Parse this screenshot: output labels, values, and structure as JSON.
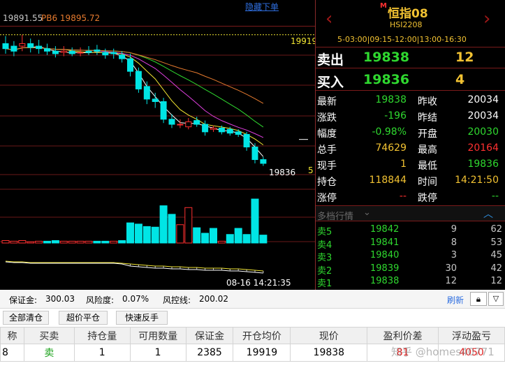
{
  "chart": {
    "ma_label": "19891.55",
    "pb_label": "PB6 19895.72",
    "hide_link": "隐藏下单",
    "high_price": "19919",
    "last_price": "19836",
    "arrow_label": "5",
    "datetime": "08-16 14:21:35",
    "candles": [
      {
        "o": 19912,
        "c": 19908,
        "h": 19918,
        "l": 19904
      },
      {
        "o": 19910,
        "c": 19906,
        "h": 19914,
        "l": 19902
      },
      {
        "o": 19910,
        "c": 19912,
        "h": 19919,
        "l": 19906
      },
      {
        "o": 19912,
        "c": 19909,
        "h": 19916,
        "l": 19905
      },
      {
        "o": 19910,
        "c": 19908,
        "h": 19915,
        "l": 19904
      },
      {
        "o": 19908,
        "c": 19906,
        "h": 19912,
        "l": 19903
      },
      {
        "o": 19906,
        "c": 19904,
        "h": 19910,
        "l": 19901
      },
      {
        "o": 19905,
        "c": 19906,
        "h": 19910,
        "l": 19902
      },
      {
        "o": 19906,
        "c": 19904,
        "h": 19909,
        "l": 19902
      },
      {
        "o": 19905,
        "c": 19905,
        "h": 19909,
        "l": 19902
      },
      {
        "o": 19906,
        "c": 19905,
        "h": 19910,
        "l": 19903
      },
      {
        "o": 19907,
        "c": 19906,
        "h": 19911,
        "l": 19903
      },
      {
        "o": 19905,
        "c": 19903,
        "h": 19908,
        "l": 19900
      },
      {
        "o": 19905,
        "c": 19904,
        "h": 19908,
        "l": 19900
      },
      {
        "o": 19903,
        "c": 19900,
        "h": 19906,
        "l": 19897
      },
      {
        "o": 19900,
        "c": 19890,
        "h": 19904,
        "l": 19886
      },
      {
        "o": 19890,
        "c": 19876,
        "h": 19893,
        "l": 19873
      },
      {
        "o": 19878,
        "c": 19868,
        "h": 19882,
        "l": 19864
      },
      {
        "o": 19868,
        "c": 19866,
        "h": 19873,
        "l": 19861
      },
      {
        "o": 19866,
        "c": 19852,
        "h": 19869,
        "l": 19849
      },
      {
        "o": 19852,
        "c": 19848,
        "h": 19856,
        "l": 19845
      },
      {
        "o": 19848,
        "c": 19848,
        "h": 19852,
        "l": 19845
      },
      {
        "o": 19846,
        "c": 19850,
        "h": 19853,
        "l": 19844
      },
      {
        "o": 19851,
        "c": 19848,
        "h": 19854,
        "l": 19846
      },
      {
        "o": 19848,
        "c": 19842,
        "h": 19851,
        "l": 19839
      },
      {
        "o": 19844,
        "c": 19845,
        "h": 19847,
        "l": 19842
      },
      {
        "o": 19845,
        "c": 19842,
        "h": 19847,
        "l": 19840
      },
      {
        "o": 19844,
        "c": 19841,
        "h": 19846,
        "l": 19839
      },
      {
        "o": 19842,
        "c": 19840,
        "h": 19844,
        "l": 19838
      },
      {
        "o": 19840,
        "c": 19830,
        "h": 19842,
        "l": 19827
      },
      {
        "o": 19830,
        "c": 19820,
        "h": 19833,
        "l": 19817
      },
      {
        "o": 19820,
        "c": 19817,
        "h": 19822,
        "l": 19815
      }
    ],
    "volume": [
      {
        "v": 4,
        "up": true
      },
      {
        "v": 3,
        "up": true
      },
      {
        "v": 4,
        "up": true
      },
      {
        "v": 2,
        "up": true
      },
      {
        "v": 3,
        "up": true
      },
      {
        "v": 3,
        "up": false
      },
      {
        "v": 4,
        "up": false
      },
      {
        "v": 3,
        "up": true
      },
      {
        "v": 3,
        "up": true
      },
      {
        "v": 3,
        "up": true
      },
      {
        "v": 3,
        "up": true
      },
      {
        "v": 3,
        "up": false
      },
      {
        "v": 3,
        "up": false
      },
      {
        "v": 3,
        "up": true
      },
      {
        "v": 4,
        "up": false
      },
      {
        "v": 33,
        "up": false
      },
      {
        "v": 31,
        "up": false
      },
      {
        "v": 27,
        "up": false
      },
      {
        "v": 26,
        "up": false
      },
      {
        "v": 61,
        "up": false
      },
      {
        "v": 47,
        "up": false
      },
      {
        "v": 30,
        "up": true
      },
      {
        "v": 58,
        "up": true
      },
      {
        "v": 25,
        "up": false
      },
      {
        "v": 16,
        "up": false
      },
      {
        "v": 24,
        "up": false
      },
      {
        "v": 3,
        "up": true
      },
      {
        "v": 14,
        "up": false
      },
      {
        "v": 24,
        "up": false
      },
      {
        "v": 14,
        "up": false
      },
      {
        "v": 72,
        "up": false
      },
      {
        "v": 13,
        "up": false
      }
    ]
  },
  "quote": {
    "title": "恒指08",
    "badge": "M",
    "code": "HSI2208",
    "session": "5-03:00|09:15-12:00|13:00-16:30",
    "sell_label": "卖出",
    "sell_price": "19838",
    "sell_qty": "12",
    "buy_label": "买入",
    "buy_price": "19836",
    "buy_qty": "4",
    "rows": [
      {
        "l1": "最新",
        "v1": "19838",
        "c1": "#2fd82f",
        "l2": "昨收",
        "v2": "20034",
        "c2": "#ffffff"
      },
      {
        "l1": "涨跌",
        "v1": "-196",
        "c1": "#2fd82f",
        "l2": "昨结",
        "v2": "20034",
        "c2": "#ffffff"
      },
      {
        "l1": "幅度",
        "v1": "-0.98%",
        "c1": "#2fd82f",
        "l2": "开盘",
        "v2": "20030",
        "c2": "#2fd82f"
      },
      {
        "l1": "总手",
        "v1": "74629",
        "c1": "#f2c232",
        "l2": "最高",
        "v2": "20164",
        "c2": "#ff3030"
      },
      {
        "l1": "现手",
        "v1": "1",
        "c1": "#f2c232",
        "l2": "最低",
        "v2": "19836",
        "c2": "#2fd82f"
      },
      {
        "l1": "持仓",
        "v1": "118844",
        "c1": "#f2c232",
        "l2": "时间",
        "v2": "14:21:50",
        "c2": "#f2c232"
      },
      {
        "l1": "涨停",
        "v1": "--",
        "c1": "#ff3030",
        "l2": "跌停",
        "v2": "--",
        "c2": "#2fd82f"
      }
    ],
    "depth_title": "多档行情",
    "depth": [
      {
        "label": "卖5",
        "price": "19842",
        "qty": "9",
        "total": "62"
      },
      {
        "label": "卖4",
        "price": "19841",
        "qty": "8",
        "total": "53"
      },
      {
        "label": "卖3",
        "price": "19840",
        "qty": "3",
        "total": "45"
      },
      {
        "label": "卖2",
        "price": "19839",
        "qty": "30",
        "total": "42"
      },
      {
        "label": "卖1",
        "price": "19838",
        "qty": "12",
        "total": "12"
      }
    ]
  },
  "account": {
    "margin_label": "保证金:",
    "margin_value": "300.03",
    "risk_label": "风险度:",
    "risk_value": "0.07%",
    "control_label": "风控线:",
    "control_value": "200.02",
    "refresh": "刷新"
  },
  "buttons": {
    "close_all": "全部清仓",
    "super_close": "超价平仓",
    "reverse": "快速反手"
  },
  "positions": {
    "headers": [
      "称",
      "买卖",
      "持仓量",
      "可用数量",
      "保证金",
      "开仓均价",
      "现价",
      "盈利价差",
      "浮动盈亏"
    ],
    "rows": [
      [
        "8",
        "卖",
        "1",
        "1",
        "2385",
        "19919",
        "19838",
        "81",
        "4050"
      ]
    ]
  },
  "watermark": "知乎 @homes40771",
  "colors": {
    "rise": "#ff3030",
    "fall": "#00e5e5",
    "accent": "#f2c232",
    "green": "#2fd82f"
  }
}
